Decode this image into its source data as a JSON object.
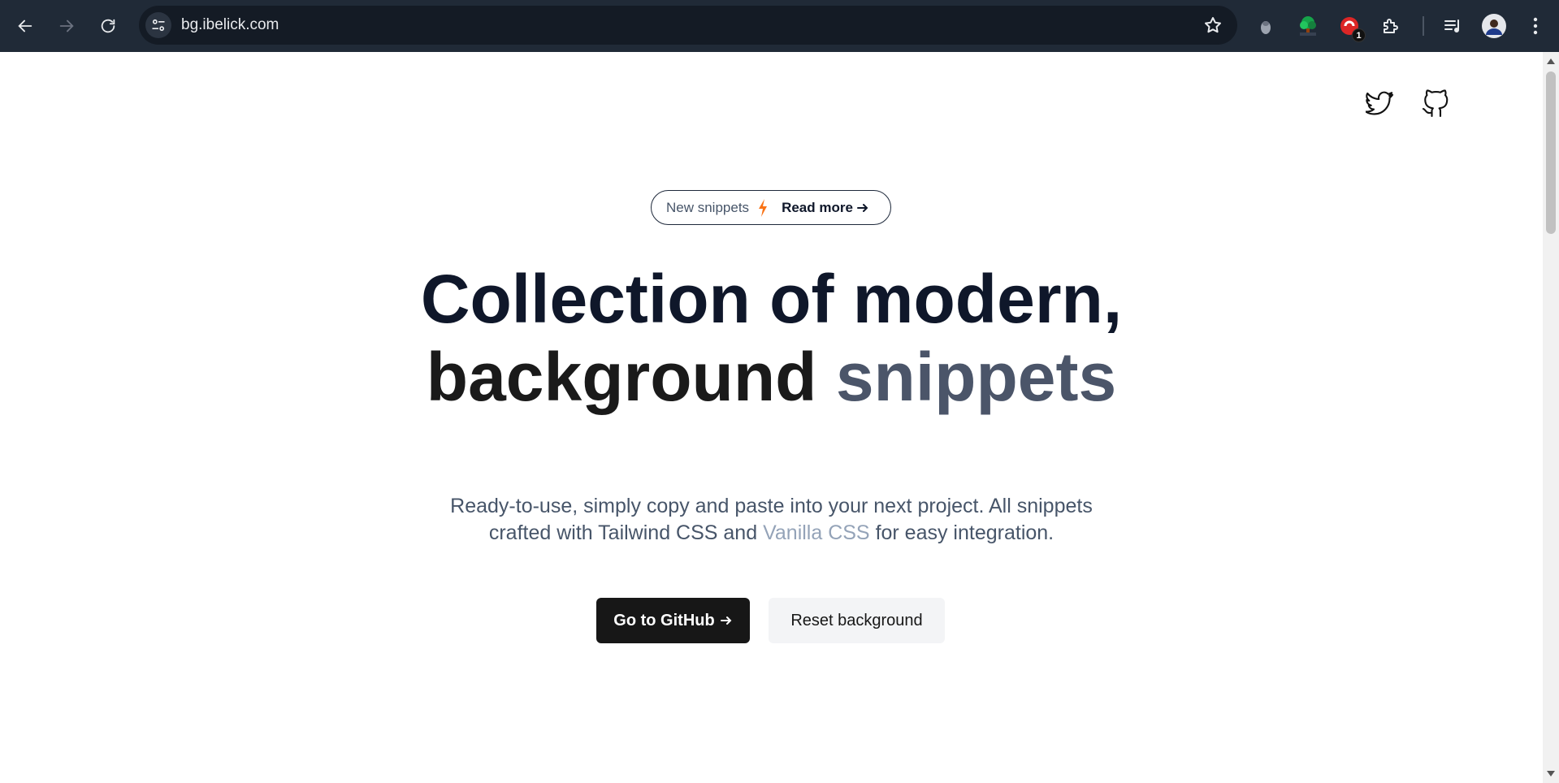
{
  "browser": {
    "url": "bg.ibelick.com",
    "extension_badge": "1",
    "icons": [
      "back-arrow-icon",
      "forward-arrow-icon",
      "reload-icon",
      "site-info-icon",
      "bookmark-star-icon",
      "extension-icon",
      "tree-extension-icon",
      "red-extension-icon",
      "puzzle-icon",
      "media-control-icon",
      "profile-avatar",
      "kebab-menu-icon"
    ]
  },
  "header": {
    "icons": [
      "twitter-icon",
      "github-icon"
    ]
  },
  "announcement": {
    "left_text": "New snippets",
    "right_text": "Read more",
    "bolt_color": "#f97316"
  },
  "hero": {
    "line1": "Collection of modern,",
    "line2_dark": "background",
    "line2_grey": "snippets",
    "sub_line1": "Ready-to-use, simply copy and paste into your next project. All snippets",
    "sub_line2_a": "crafted with Tailwind CSS and",
    "sub_line2_vanilla": "Vanilla CSS",
    "sub_line2_b": "for easy integration."
  },
  "buttons": {
    "primary": "Go to GitHub",
    "secondary": "Reset background"
  },
  "colors": {
    "chrome_bg": "#202a37",
    "omnibox_bg": "#141b25",
    "headline": "#0f172a",
    "headline_grey": "#4b5569",
    "primary_button": "#171717"
  }
}
